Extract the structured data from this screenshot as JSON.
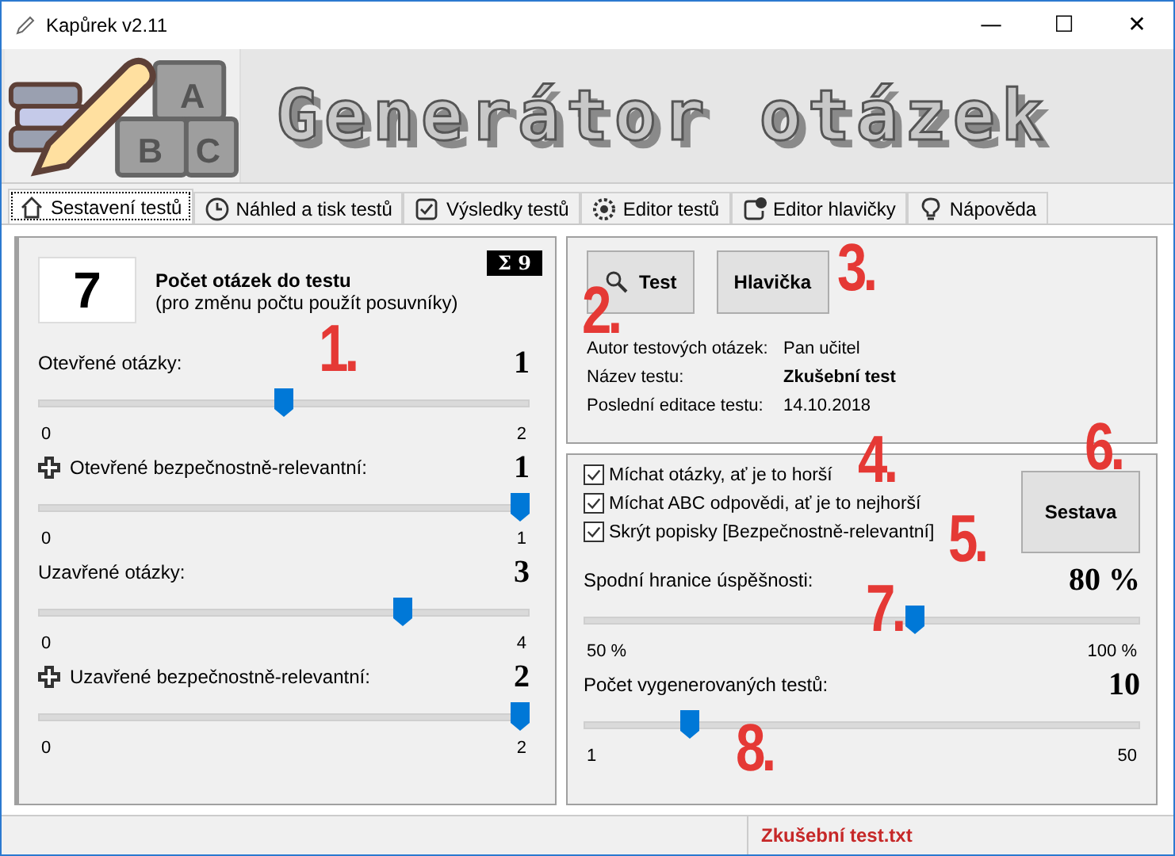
{
  "window": {
    "title": "Kapůrek v2.11",
    "controls": [
      "—",
      "☐",
      "✕"
    ]
  },
  "banner": {
    "logo_letters": [
      "A",
      "B",
      "C"
    ],
    "title": "Generátor otázek"
  },
  "tabs": [
    {
      "label": "Sestavení testů",
      "selected": true
    },
    {
      "label": "Náhled a tisk testů",
      "selected": false
    },
    {
      "label": "Výsledky testů",
      "selected": false
    },
    {
      "label": "Editor testů",
      "selected": false
    },
    {
      "label": "Editor hlavičky",
      "selected": false
    },
    {
      "label": "Nápověda",
      "selected": false
    }
  ],
  "left": {
    "count": "7",
    "count_title": "Počet otázek do testu",
    "count_hint": "(pro změnu počtu použít posuvníky)",
    "sum": "Σ 9",
    "sliders": [
      {
        "label": "Otevřené otázky:",
        "safety": false,
        "value": "1",
        "min": "0",
        "max": "2",
        "level": 0.5
      },
      {
        "label": "Otevřené bezpečnostně-relevantní:",
        "safety": true,
        "value": "1",
        "min": "0",
        "max": "1",
        "level": 1
      },
      {
        "label": "Uzavřené otázky:",
        "safety": false,
        "value": "3",
        "min": "0",
        "max": "4",
        "level": 0.75
      },
      {
        "label": "Uzavřené bezpečnostně-relevantní:",
        "safety": true,
        "value": "2",
        "min": "0",
        "max": "2",
        "level": 1
      }
    ]
  },
  "info": {
    "buttons": [
      {
        "label": "Test"
      },
      {
        "label": "Hlavička"
      }
    ],
    "rows": [
      {
        "label": "Autor testových otázek:",
        "value": "Pan učitel",
        "bold": false
      },
      {
        "label": "Název testu:",
        "value": "Zkušební test",
        "bold": true
      },
      {
        "label": "Poslední editace testu:",
        "value": "14.10.2018",
        "bold": false
      }
    ]
  },
  "options": {
    "checkboxes": [
      {
        "label": "Míchat otázky, ať je to horší",
        "checked": true
      },
      {
        "label": "Míchat ABC odpovědi, ať je to nejhorší",
        "checked": true
      },
      {
        "label": "Skrýt popisky [Bezpečnostně-relevantní]",
        "checked": true
      }
    ],
    "button": "Sestava",
    "sliders": [
      {
        "label": "Spodní hranice úspěšnosti:",
        "value": "80 %",
        "min": "50 %",
        "max": "100 %",
        "level": 0.6
      },
      {
        "label": "Počet vygenerovaných testů:",
        "value": "10",
        "min": "1",
        "max": "50",
        "level": 0.18
      }
    ]
  },
  "annotations": [
    "1.",
    "2.",
    "3.",
    "4.",
    "5.",
    "6.",
    "7.",
    "8."
  ],
  "status_bar": {
    "file": "Zkušební test.txt"
  }
}
